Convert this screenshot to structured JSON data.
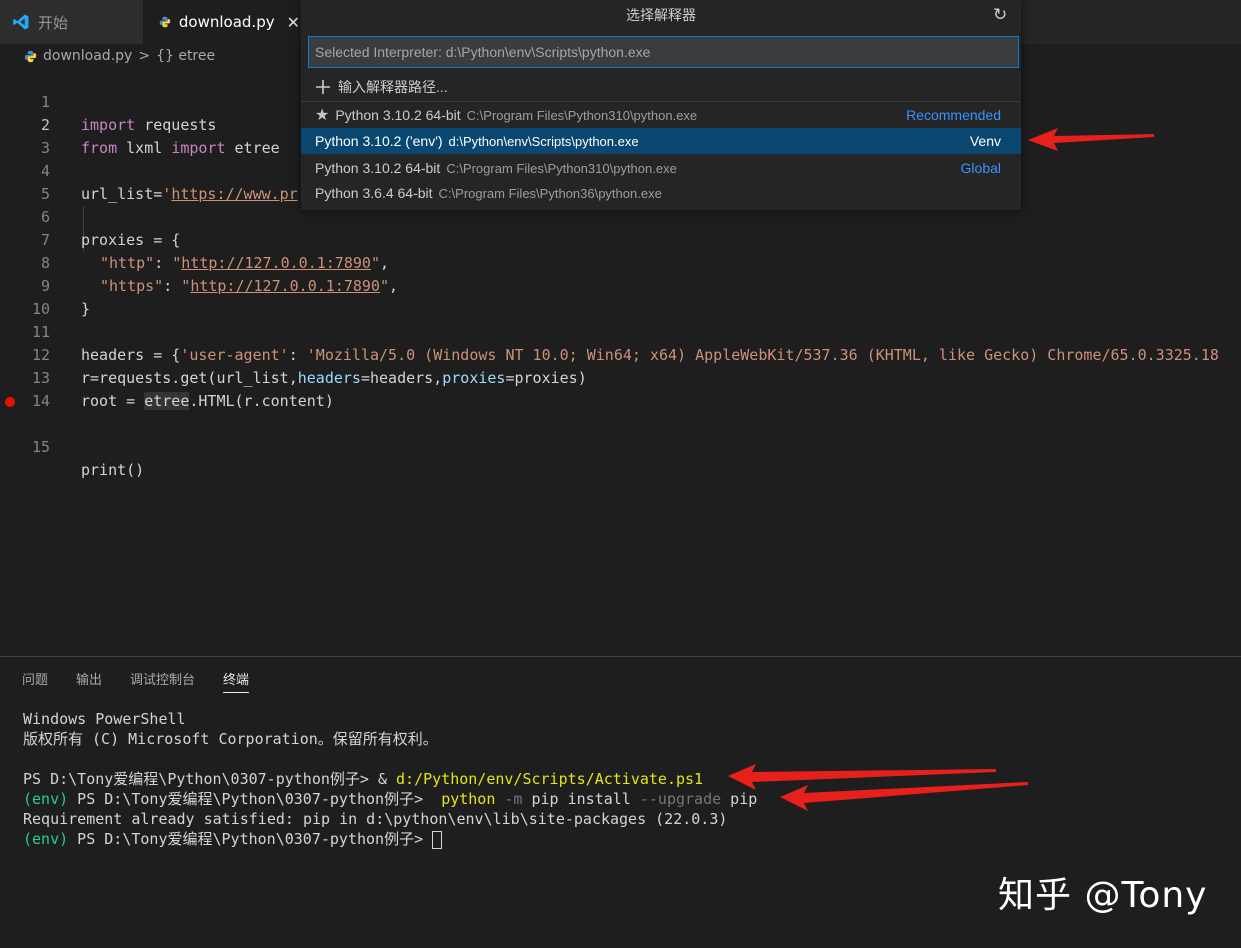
{
  "tabs": [
    {
      "label": "开始",
      "icon": "vscode-icon"
    },
    {
      "label": "download.py",
      "icon": "python-icon",
      "close": "✕"
    }
  ],
  "breadcrumb": {
    "file": "download.py",
    "separator": ">",
    "symbol": "{} etree"
  },
  "editor": {
    "line_numbers": [
      "1",
      "2",
      "3",
      "4",
      "5",
      "6",
      "7",
      "8",
      "9",
      "10",
      "11",
      "12",
      "13",
      "14",
      "15"
    ],
    "lines": {
      "l1": {
        "kw": "import",
        "rest": " requests"
      },
      "l2": {
        "kw1": "from",
        "mid": " lxml ",
        "kw2": "import",
        "rest": " etree"
      },
      "l4": {
        "var": "url_list=",
        "str": "'",
        "url": "https://www.pr"
      },
      "l6": "proxies = {",
      "l7": {
        "key": "\"http\"",
        "colon": ": ",
        "q1": "\"",
        "url": "http://127.0.0.1:7890",
        "q2": "\"",
        "comma": ","
      },
      "l8": {
        "key": "\"https\"",
        "colon": ": ",
        "q1": "\"",
        "url": "http://127.0.0.1:7890",
        "q2": "\"",
        "comma": ","
      },
      "l9": "}",
      "l11": {
        "pre": "headers = {",
        "key": "'user-agent'",
        "colon": ": ",
        "val": "'Mozilla/5.0 (Windows NT 10.0; Win64; x64) AppleWebKit/537.36 (KHTML, like Gecko) Chrome/65.0.3325.18"
      },
      "l12": {
        "a": "r=requests.get(url_list,",
        "p1": "headers",
        "b": "=headers,",
        "p2": "proxies",
        "c": "=proxies)"
      },
      "l13": {
        "a": "root = ",
        "hl": "etree",
        "b": ".HTML(r.content)"
      },
      "l15": "print()"
    }
  },
  "quick_pick": {
    "title": "选择解释器",
    "refresh_icon": "↻",
    "input_placeholder": "Selected Interpreter: d:\\Python\\env\\Scripts\\python.exe",
    "enter_path": "输入解释器路径...",
    "items": [
      {
        "name": "Python 3.10.2 64-bit",
        "path": "C:\\Program Files\\Python310\\python.exe",
        "tag": "Recommended",
        "star": "★"
      },
      {
        "name": "Python 3.10.2 ('env')",
        "path": "d:\\Python\\env\\Scripts\\python.exe",
        "tag": "Venv"
      },
      {
        "name": "Python 3.10.2 64-bit",
        "path": "C:\\Program Files\\Python310\\python.exe",
        "tag": "Global"
      },
      {
        "name": "Python 3.6.4 64-bit",
        "path": "C:\\Program Files\\Python36\\python.exe",
        "tag": ""
      }
    ]
  },
  "panel": {
    "tabs": [
      "问题",
      "输出",
      "调试控制台",
      "终端"
    ],
    "terminal": {
      "l1": "Windows PowerShell",
      "l2": "版权所有 (C) Microsoft Corporation。保留所有权利。",
      "l4": {
        "prompt": "PS D:\\Tony爱编程\\Python\\0307-python例子> ",
        "amp": "& ",
        "cmd": "d:/Python/env/Scripts/Activate.ps1"
      },
      "l5": {
        "env": "(env)",
        "prompt": " PS D:\\Tony爱编程\\Python\\0307-python例子>  ",
        "cmd": "python",
        "f1": " -m",
        "a1": " pip install",
        "f2": " --upgrade",
        "a2": " pip"
      },
      "l6": "Requirement already satisfied: pip in d:\\python\\env\\lib\\site-packages (22.0.3)",
      "l7": {
        "env": "(env)",
        "prompt": " PS D:\\Tony爱编程\\Python\\0307-python例子> "
      }
    }
  },
  "watermark": "知乎 @Tony",
  "colors": {
    "accent": "#007fd4",
    "selected": "#094771",
    "arrow": "#e8201c"
  }
}
